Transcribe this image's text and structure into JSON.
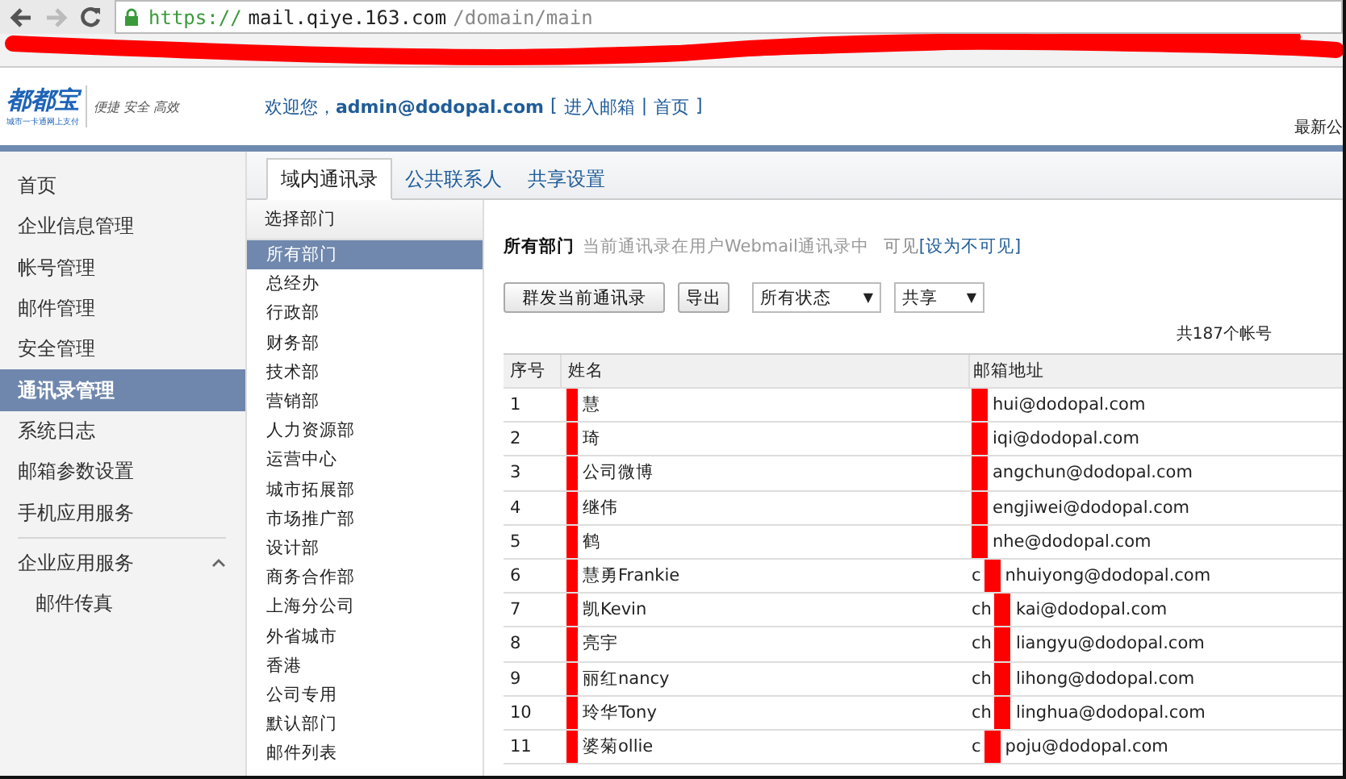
{
  "browser": {
    "url": {
      "scheme": "https://",
      "host": "mail.qiye.163.com",
      "path": "/domain/main"
    }
  },
  "header": {
    "logo": "都都宝",
    "logo_sub": "城市一卡通网上支付",
    "tagline": "便捷 安全 高效",
    "welcome": "欢迎您，**admin@dodopal.com**",
    "brackets": [
      "[",
      "|",
      "]"
    ],
    "links": [
      "进入邮箱",
      "首页"
    ],
    "right_text": "最新公"
  },
  "sidebar": {
    "items": [
      {
        "label": "首页",
        "selected": false
      },
      {
        "label": "企业信息管理",
        "selected": false
      },
      {
        "label": "帐号管理",
        "selected": false
      },
      {
        "label": "邮件管理",
        "selected": false
      },
      {
        "label": "安全管理",
        "selected": false
      },
      {
        "label": "通讯录管理",
        "selected": true
      },
      {
        "label": "系统日志",
        "selected": false
      },
      {
        "label": "邮箱参数设置",
        "selected": false
      },
      {
        "label": "手机应用服务",
        "selected": false
      },
      {
        "label": "企业应用服务",
        "selected": false,
        "expanded": true,
        "children": [
          {
            "label": "邮件传真",
            "selected": false
          }
        ]
      }
    ]
  },
  "tabs": [
    {
      "label": "域内通讯录",
      "selected": true
    },
    {
      "label": "公共联系人",
      "selected": false
    },
    {
      "label": "共享设置",
      "selected": false
    }
  ],
  "departments": {
    "title": "选择部门",
    "items": [
      {
        "label": "所有部门",
        "selected": true
      },
      {
        "label": "总经办",
        "selected": false
      },
      {
        "label": "行政部",
        "selected": false
      },
      {
        "label": "财务部",
        "selected": false
      },
      {
        "label": "技术部",
        "selected": false
      },
      {
        "label": "营销部",
        "selected": false
      },
      {
        "label": "人力资源部",
        "selected": false
      },
      {
        "label": "运营中心",
        "selected": false
      },
      {
        "label": "城市拓展部",
        "selected": false
      },
      {
        "label": "市场推广部",
        "selected": false
      },
      {
        "label": "设计部",
        "selected": false
      },
      {
        "label": "商务合作部",
        "selected": false
      },
      {
        "label": "上海分公司",
        "selected": false
      },
      {
        "label": "外省城市",
        "selected": false
      },
      {
        "label": "香港",
        "selected": false
      },
      {
        "label": "公司专用",
        "selected": false
      },
      {
        "label": "默认部门",
        "selected": false
      },
      {
        "label": "邮件列表",
        "selected": false
      }
    ]
  },
  "info": {
    "department": "所有部门",
    "note": "当前通讯录在用户Webmail通讯录中",
    "state": "可见",
    "action": "[设为不可见]"
  },
  "toolbar": {
    "buttons": [
      "群发当前通讯录",
      "导出"
    ],
    "selects": [
      {
        "value": "所有状态",
        "arrow": "▼"
      },
      {
        "value": "共享",
        "arrow": "▼"
      }
    ]
  },
  "count": "共187个帐号",
  "table": {
    "columns": [
      "序号",
      "姓名",
      "邮箱地址"
    ],
    "rows": [
      {
        "no": "1",
        "name": "慧",
        "email": "hui@dodopal.com"
      },
      {
        "no": "2",
        "name": "琦",
        "email": "iqi@dodopal.com"
      },
      {
        "no": "3",
        "name": "公司微博",
        "email": "angchun@dodopal.com"
      },
      {
        "no": "4",
        "name": "继伟",
        "email": "engjiwei@dodopal.com"
      },
      {
        "no": "5",
        "name": "鹤",
        "email": "nhe@dodopal.com"
      },
      {
        "no": "6",
        "name": "慧勇Frankie",
        "email_prefix": "c",
        "email": "nhuiyong@dodopal.com"
      },
      {
        "no": "7",
        "name": "凯Kevin",
        "email_prefix": "ch",
        "email": "kai@dodopal.com"
      },
      {
        "no": "8",
        "name": "亮宇",
        "email_prefix": "ch",
        "email": "liangyu@dodopal.com"
      },
      {
        "no": "9",
        "name": "丽红nancy",
        "email_prefix": "ch",
        "email": "lihong@dodopal.com"
      },
      {
        "no": "10",
        "name": "玲华Tony",
        "email_prefix": "ch",
        "email": "linghua@dodopal.com"
      },
      {
        "no": "11",
        "name": "婆菊ollie",
        "email_prefix": "c",
        "email": "poju@dodopal.com"
      }
    ]
  }
}
